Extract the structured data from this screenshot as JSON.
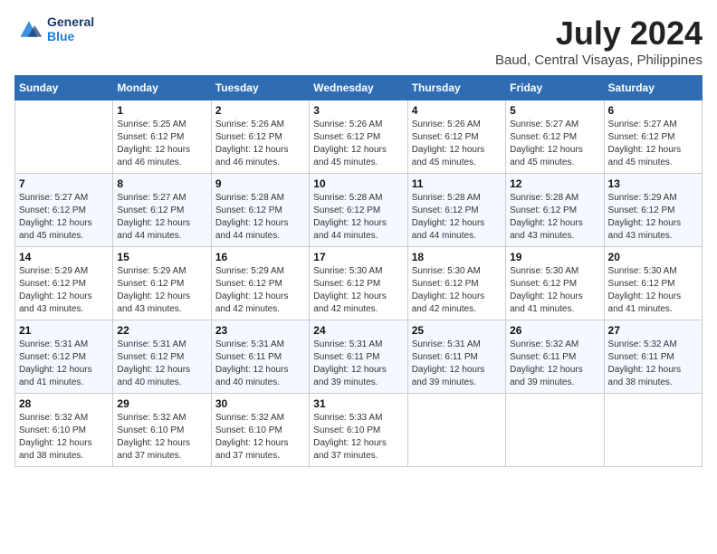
{
  "header": {
    "logo_line1": "General",
    "logo_line2": "Blue",
    "title": "July 2024",
    "subtitle": "Baud, Central Visayas, Philippines"
  },
  "weekdays": [
    "Sunday",
    "Monday",
    "Tuesday",
    "Wednesday",
    "Thursday",
    "Friday",
    "Saturday"
  ],
  "weeks": [
    [
      {
        "day": "",
        "info": ""
      },
      {
        "day": "1",
        "info": "Sunrise: 5:25 AM\nSunset: 6:12 PM\nDaylight: 12 hours\nand 46 minutes."
      },
      {
        "day": "2",
        "info": "Sunrise: 5:26 AM\nSunset: 6:12 PM\nDaylight: 12 hours\nand 46 minutes."
      },
      {
        "day": "3",
        "info": "Sunrise: 5:26 AM\nSunset: 6:12 PM\nDaylight: 12 hours\nand 45 minutes."
      },
      {
        "day": "4",
        "info": "Sunrise: 5:26 AM\nSunset: 6:12 PM\nDaylight: 12 hours\nand 45 minutes."
      },
      {
        "day": "5",
        "info": "Sunrise: 5:27 AM\nSunset: 6:12 PM\nDaylight: 12 hours\nand 45 minutes."
      },
      {
        "day": "6",
        "info": "Sunrise: 5:27 AM\nSunset: 6:12 PM\nDaylight: 12 hours\nand 45 minutes."
      }
    ],
    [
      {
        "day": "7",
        "info": "Sunrise: 5:27 AM\nSunset: 6:12 PM\nDaylight: 12 hours\nand 45 minutes."
      },
      {
        "day": "8",
        "info": "Sunrise: 5:27 AM\nSunset: 6:12 PM\nDaylight: 12 hours\nand 44 minutes."
      },
      {
        "day": "9",
        "info": "Sunrise: 5:28 AM\nSunset: 6:12 PM\nDaylight: 12 hours\nand 44 minutes."
      },
      {
        "day": "10",
        "info": "Sunrise: 5:28 AM\nSunset: 6:12 PM\nDaylight: 12 hours\nand 44 minutes."
      },
      {
        "day": "11",
        "info": "Sunrise: 5:28 AM\nSunset: 6:12 PM\nDaylight: 12 hours\nand 44 minutes."
      },
      {
        "day": "12",
        "info": "Sunrise: 5:28 AM\nSunset: 6:12 PM\nDaylight: 12 hours\nand 43 minutes."
      },
      {
        "day": "13",
        "info": "Sunrise: 5:29 AM\nSunset: 6:12 PM\nDaylight: 12 hours\nand 43 minutes."
      }
    ],
    [
      {
        "day": "14",
        "info": "Sunrise: 5:29 AM\nSunset: 6:12 PM\nDaylight: 12 hours\nand 43 minutes."
      },
      {
        "day": "15",
        "info": "Sunrise: 5:29 AM\nSunset: 6:12 PM\nDaylight: 12 hours\nand 43 minutes."
      },
      {
        "day": "16",
        "info": "Sunrise: 5:29 AM\nSunset: 6:12 PM\nDaylight: 12 hours\nand 42 minutes."
      },
      {
        "day": "17",
        "info": "Sunrise: 5:30 AM\nSunset: 6:12 PM\nDaylight: 12 hours\nand 42 minutes."
      },
      {
        "day": "18",
        "info": "Sunrise: 5:30 AM\nSunset: 6:12 PM\nDaylight: 12 hours\nand 42 minutes."
      },
      {
        "day": "19",
        "info": "Sunrise: 5:30 AM\nSunset: 6:12 PM\nDaylight: 12 hours\nand 41 minutes."
      },
      {
        "day": "20",
        "info": "Sunrise: 5:30 AM\nSunset: 6:12 PM\nDaylight: 12 hours\nand 41 minutes."
      }
    ],
    [
      {
        "day": "21",
        "info": "Sunrise: 5:31 AM\nSunset: 6:12 PM\nDaylight: 12 hours\nand 41 minutes."
      },
      {
        "day": "22",
        "info": "Sunrise: 5:31 AM\nSunset: 6:12 PM\nDaylight: 12 hours\nand 40 minutes."
      },
      {
        "day": "23",
        "info": "Sunrise: 5:31 AM\nSunset: 6:11 PM\nDaylight: 12 hours\nand 40 minutes."
      },
      {
        "day": "24",
        "info": "Sunrise: 5:31 AM\nSunset: 6:11 PM\nDaylight: 12 hours\nand 39 minutes."
      },
      {
        "day": "25",
        "info": "Sunrise: 5:31 AM\nSunset: 6:11 PM\nDaylight: 12 hours\nand 39 minutes."
      },
      {
        "day": "26",
        "info": "Sunrise: 5:32 AM\nSunset: 6:11 PM\nDaylight: 12 hours\nand 39 minutes."
      },
      {
        "day": "27",
        "info": "Sunrise: 5:32 AM\nSunset: 6:11 PM\nDaylight: 12 hours\nand 38 minutes."
      }
    ],
    [
      {
        "day": "28",
        "info": "Sunrise: 5:32 AM\nSunset: 6:10 PM\nDaylight: 12 hours\nand 38 minutes."
      },
      {
        "day": "29",
        "info": "Sunrise: 5:32 AM\nSunset: 6:10 PM\nDaylight: 12 hours\nand 37 minutes."
      },
      {
        "day": "30",
        "info": "Sunrise: 5:32 AM\nSunset: 6:10 PM\nDaylight: 12 hours\nand 37 minutes."
      },
      {
        "day": "31",
        "info": "Sunrise: 5:33 AM\nSunset: 6:10 PM\nDaylight: 12 hours\nand 37 minutes."
      },
      {
        "day": "",
        "info": ""
      },
      {
        "day": "",
        "info": ""
      },
      {
        "day": "",
        "info": ""
      }
    ]
  ]
}
